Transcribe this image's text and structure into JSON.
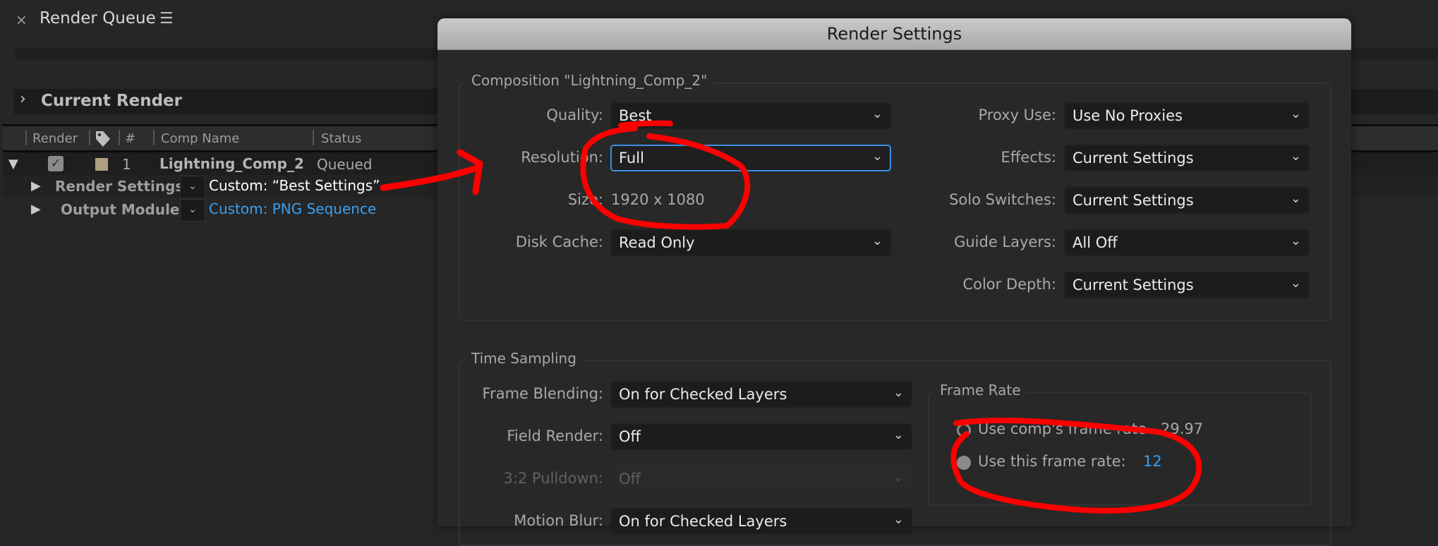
{
  "render_queue": {
    "title": "Render Queue",
    "close_icon": "×",
    "menu_icon": "☰",
    "current_render_label": "Current Render",
    "columns": [
      "Render",
      "#",
      "Comp Name",
      "Status"
    ],
    "items": [
      {
        "checked": true,
        "label_color": "#b09e7e",
        "number": "1",
        "comp_name": "Lightning_Comp_2",
        "status": "Queued",
        "render_settings_label": "Render Settings:",
        "render_settings_value": "Custom: “Best Settings”",
        "output_module_label": "Output Module:",
        "output_module_value": "Custom: PNG Sequence"
      }
    ]
  },
  "dialog": {
    "title": "Render Settings",
    "composition": {
      "legend": "Composition \"Lightning_Comp_2\"",
      "quality": {
        "label": "Quality:",
        "value": "Best"
      },
      "resolution": {
        "label": "Resolution:",
        "value": "Full"
      },
      "size": {
        "label": "Size:",
        "value": "1920 x 1080"
      },
      "disk_cache": {
        "label": "Disk Cache:",
        "value": "Read Only"
      },
      "proxy_use": {
        "label": "Proxy Use:",
        "value": "Use No Proxies"
      },
      "effects": {
        "label": "Effects:",
        "value": "Current Settings"
      },
      "solo_switches": {
        "label": "Solo Switches:",
        "value": "Current Settings"
      },
      "guide_layers": {
        "label": "Guide Layers:",
        "value": "All Off"
      },
      "color_depth": {
        "label": "Color Depth:",
        "value": "Current Settings"
      }
    },
    "time_sampling": {
      "legend": "Time Sampling",
      "frame_blending": {
        "label": "Frame Blending:",
        "value": "On for Checked Layers"
      },
      "field_render": {
        "label": "Field Render:",
        "value": "Off"
      },
      "pulldown": {
        "label": "3:2 Pulldown:",
        "value": "Off"
      },
      "motion_blur": {
        "label": "Motion Blur:",
        "value": "On for Checked Layers"
      },
      "frame_rate": {
        "legend": "Frame Rate",
        "use_comp_label": "Use comp's frame rate",
        "comp_rate": "29.97",
        "use_this_label": "Use this frame rate:",
        "this_rate": "12",
        "selected": "use_this"
      }
    }
  },
  "colors": {
    "accent_blue": "#3aa0f0",
    "annotation_red": "#ff0000",
    "focus_border": "#3b8ee6"
  }
}
